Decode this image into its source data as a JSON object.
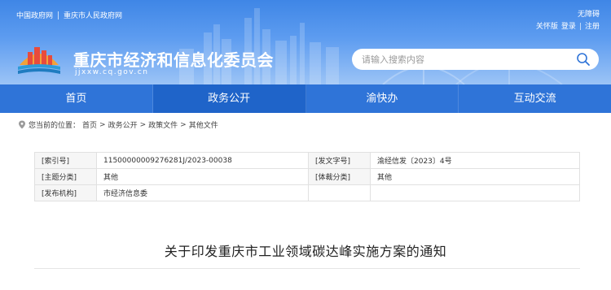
{
  "header": {
    "top_links": [
      "中国政府网",
      "重庆市人民政府网"
    ],
    "util_accessibility": "无障碍",
    "util_care_mode": "关怀版",
    "util_login": "登录",
    "util_separator": "|",
    "util_register": "注册",
    "site_title": "重庆市经济和信息化委员会",
    "site_domain": "jjxxw.cq.gov.cn",
    "search_placeholder": "请输入搜索内容"
  },
  "nav": {
    "items": [
      "首页",
      "政务公开",
      "渝快办",
      "互动交流"
    ],
    "active_index": 1
  },
  "breadcrumb": {
    "prefix": "您当前的位置：",
    "items": [
      "首页",
      "政务公开",
      "政策文件",
      "其他文件"
    ],
    "separator": ">"
  },
  "info": {
    "rows": [
      {
        "k1": "[索引号]",
        "v1": "11500000009276281J/2023-00038",
        "k2": "[发文字号]",
        "v2": "渝经信发〔2023〕4号"
      },
      {
        "k1": "[主题分类]",
        "v1": "其他",
        "k2": "[体裁分类]",
        "v2": "其他"
      },
      {
        "k1": "[发布机构]",
        "v1": "市经济信息委",
        "k2": "",
        "v2": ""
      }
    ]
  },
  "article": {
    "title": "关于印发重庆市工业领域碳达峰实施方案的通知"
  },
  "colors": {
    "banner": "#3f86e6",
    "nav": "#2f74d8",
    "nav_active": "#1f64c9"
  }
}
